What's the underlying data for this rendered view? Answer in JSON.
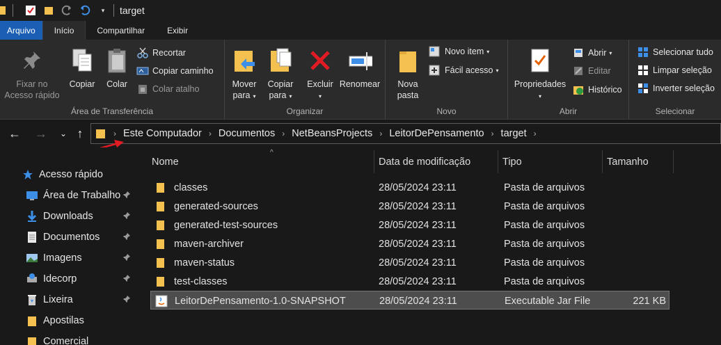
{
  "window": {
    "title": "target"
  },
  "tabs": [
    {
      "label": "Arquivo"
    },
    {
      "label": "Início"
    },
    {
      "label": "Compartilhar"
    },
    {
      "label": "Exibir"
    }
  ],
  "ribbon": {
    "clipboard": {
      "label": "Área de Transferência",
      "pin": "Fixar no\nAcesso rápido",
      "copy": "Copiar",
      "paste": "Colar",
      "cut": "Recortar",
      "copy_path": "Copiar caminho",
      "paste_shortcut": "Colar atalho"
    },
    "organize": {
      "label": "Organizar",
      "move_to": "Mover\npara",
      "copy_to": "Copiar\npara",
      "delete": "Excluir",
      "rename": "Renomear"
    },
    "new": {
      "label": "Novo",
      "new_folder": "Nova\npasta",
      "new_item": "Novo item",
      "easy_access": "Fácil acesso"
    },
    "open": {
      "label": "Abrir",
      "properties": "Propriedades",
      "open": "Abrir",
      "edit": "Editar",
      "history": "Histórico"
    },
    "select": {
      "label": "Selecionar",
      "select_all": "Selecionar tudo",
      "select_none": "Limpar seleção",
      "invert": "Inverter seleção"
    }
  },
  "breadcrumb": [
    "Este Computador",
    "Documentos",
    "NetBeansProjects",
    "LeitorDePensamento",
    "target"
  ],
  "navpane": [
    {
      "label": "Acesso rápido",
      "icon": "star-icon",
      "pinned": false
    },
    {
      "label": "Área de Trabalho",
      "icon": "desktop-icon",
      "pinned": true
    },
    {
      "label": "Downloads",
      "icon": "download-icon",
      "pinned": true
    },
    {
      "label": "Documentos",
      "icon": "document-icon",
      "pinned": true
    },
    {
      "label": "Imagens",
      "icon": "image-icon",
      "pinned": true
    },
    {
      "label": "Idecorp",
      "icon": "drive-icon",
      "pinned": true
    },
    {
      "label": "Lixeira",
      "icon": "recycle-bin-icon",
      "pinned": true
    },
    {
      "label": "Apostilas",
      "icon": "folder-icon",
      "pinned": false
    },
    {
      "label": "Comercial",
      "icon": "folder-icon",
      "pinned": false
    }
  ],
  "columns": {
    "name": "Nome",
    "date": "Data de modificação",
    "type": "Tipo",
    "size": "Tamanho"
  },
  "files": [
    {
      "name": "classes",
      "date": "28/05/2024 23:11",
      "type": "Pasta de arquivos",
      "size": "",
      "icon": "folder-icon"
    },
    {
      "name": "generated-sources",
      "date": "28/05/2024 23:11",
      "type": "Pasta de arquivos",
      "size": "",
      "icon": "folder-icon"
    },
    {
      "name": "generated-test-sources",
      "date": "28/05/2024 23:11",
      "type": "Pasta de arquivos",
      "size": "",
      "icon": "folder-icon"
    },
    {
      "name": "maven-archiver",
      "date": "28/05/2024 23:11",
      "type": "Pasta de arquivos",
      "size": "",
      "icon": "folder-icon"
    },
    {
      "name": "maven-status",
      "date": "28/05/2024 23:11",
      "type": "Pasta de arquivos",
      "size": "",
      "icon": "folder-icon"
    },
    {
      "name": "test-classes",
      "date": "28/05/2024 23:11",
      "type": "Pasta de arquivos",
      "size": "",
      "icon": "folder-icon"
    },
    {
      "name": "LeitorDePensamento-1.0-SNAPSHOT",
      "date": "28/05/2024 23:11",
      "type": "Executable Jar File",
      "size": "221 KB",
      "icon": "jar-icon",
      "selected": true
    }
  ],
  "colors": {
    "accent": "#1a5fb4",
    "folder": "#f4c04f",
    "annotation": "#e01b24"
  }
}
